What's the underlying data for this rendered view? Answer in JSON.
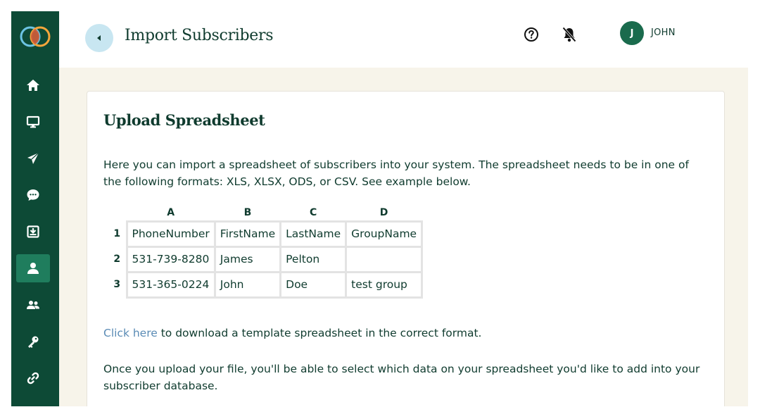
{
  "app": {
    "user_initial": "J",
    "user_name": "JOHN"
  },
  "header": {
    "title": "Import Subscribers",
    "icons": [
      "back-icon",
      "help-icon",
      "bell-off-icon",
      "kebab-menu-icon"
    ]
  },
  "sidebar": {
    "items": [
      {
        "icon": "home-icon",
        "active": false
      },
      {
        "icon": "monitor-icon",
        "active": false
      },
      {
        "icon": "send-icon",
        "active": false
      },
      {
        "icon": "chat-icon",
        "active": false
      },
      {
        "icon": "inbox-download-icon",
        "active": false
      },
      {
        "icon": "person-icon",
        "active": true
      },
      {
        "icon": "group-icon",
        "active": false
      },
      {
        "icon": "key-icon",
        "active": false
      },
      {
        "icon": "link-icon",
        "active": false
      }
    ]
  },
  "card": {
    "title": "Upload Spreadsheet",
    "intro": "Here you can import a spreadsheet of subscribers into your system. The spreadsheet needs to be in one of the following formats: XLS, XLSX, ODS, or CSV. See example below.",
    "download_link": "Click here",
    "download_rest": " to download a template spreadsheet in the correct format.",
    "outro": "Once you upload your file, you'll be able to select which data on your spreadsheet you'd like to add into your subscriber database."
  },
  "sheet": {
    "columns": [
      "A",
      "B",
      "C",
      "D"
    ],
    "rows": [
      {
        "num": "1",
        "cells": [
          "PhoneNumber",
          "FirstName",
          "LastName",
          "GroupName"
        ]
      },
      {
        "num": "2",
        "cells": [
          "531-739-8280",
          "James",
          "Pelton",
          ""
        ]
      },
      {
        "num": "3",
        "cells": [
          "531-365-0224",
          "John",
          "Doe",
          "test group"
        ]
      }
    ]
  },
  "colors": {
    "sidebar": "#0d4a36",
    "sidebar_active": "#1f7d5d",
    "accent_text": "#0f3b2e",
    "link": "#5a8bb5",
    "back_button": "#c8e6f1",
    "page_bg": "#f7f4ea"
  }
}
